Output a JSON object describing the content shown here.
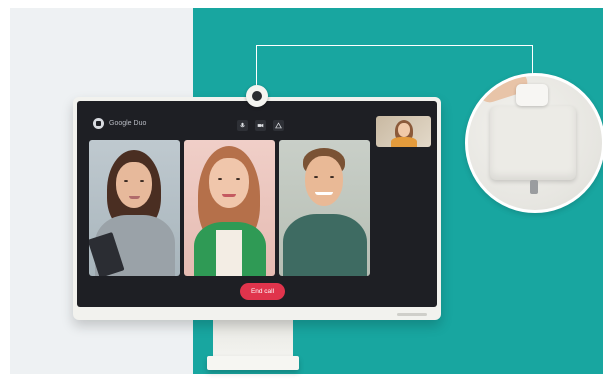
{
  "app": {
    "logo_text": "Google Duo"
  },
  "controls": {
    "mic_icon": "mic-icon",
    "camera_icon": "video-camera-icon",
    "more_icon": "menu-icon"
  },
  "call": {
    "end_label": "End call"
  },
  "colors": {
    "accent_teal": "#18a6a0",
    "end_call_red": "#e0344c",
    "screen_bg": "#1e1f24"
  }
}
